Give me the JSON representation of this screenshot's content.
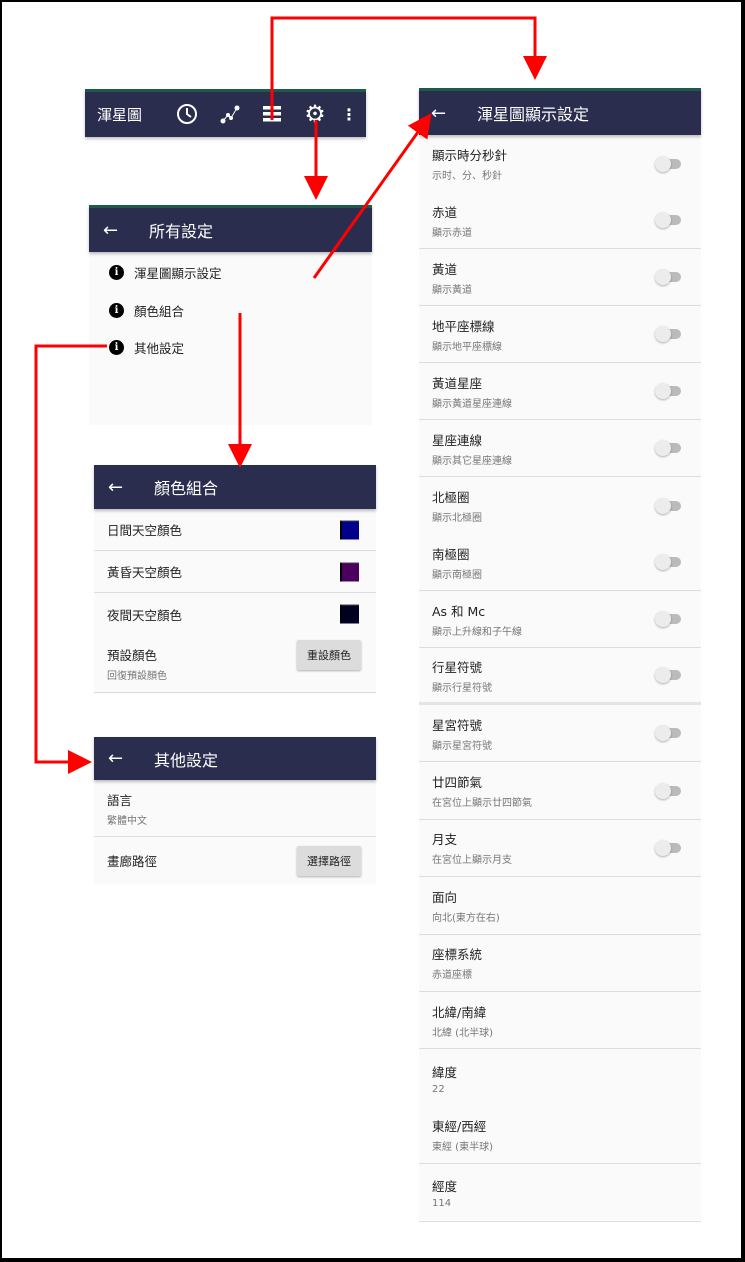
{
  "toolbar": {
    "title": "渾星圖",
    "icons": [
      "clock-icon",
      "constellation-icon",
      "list-icon",
      "gear-icon",
      "more-vert-icon"
    ]
  },
  "all_settings": {
    "title": "所有設定",
    "items": [
      {
        "label": "渾星圖顯示設定"
      },
      {
        "label": "顏色組合"
      },
      {
        "label": "其他設定"
      }
    ]
  },
  "color_scheme": {
    "title": "顏色組合",
    "rows": [
      {
        "label": "日間天空顏色",
        "color": "#00008b"
      },
      {
        "label": "黃昏天空顏色",
        "color": "#4b0060"
      },
      {
        "label": "夜間天空顏色",
        "color": "#000020"
      }
    ],
    "reset": {
      "label": "預設顏色",
      "sub": "回復預設顏色",
      "button": "重設顏色"
    }
  },
  "other_settings": {
    "title": "其他設定",
    "language": {
      "label": "語言",
      "value": "繁體中文"
    },
    "gallery": {
      "label": "畫廊路徑",
      "button": "選擇路徑"
    }
  },
  "display_settings": {
    "title": "渾星圖顯示設定",
    "rows": [
      {
        "label": "顯示時分秒針",
        "sub": "示时、分、秒針",
        "toggle": false
      },
      {
        "label": "赤道",
        "sub": "顯示赤道",
        "toggle": false
      },
      {
        "label": "黃道",
        "sub": "顯示黃道",
        "toggle": false
      },
      {
        "label": "地平座標線",
        "sub": "顯示地平座標線",
        "toggle": false
      },
      {
        "label": "黃道星座",
        "sub": "顯示黃道星座連線",
        "toggle": false
      },
      {
        "label": "星座連線",
        "sub": "顯示其它星座連線",
        "toggle": false
      },
      {
        "label": "北極圈",
        "sub": "顯示北極圈",
        "toggle": false
      },
      {
        "label": "南極圈",
        "sub": "顯示南極圈",
        "toggle": false
      },
      {
        "label": "As 和 Mc",
        "sub": "顯示上升線和子午線",
        "toggle": false
      },
      {
        "label": "行星符號",
        "sub": "顯示行星符號",
        "toggle": false
      },
      {
        "label": "星宮符號",
        "sub": "顯示星宮符號",
        "toggle": false
      },
      {
        "label": "廿四節氣",
        "sub": "在宮位上顯示廿四節氣",
        "toggle": false
      },
      {
        "label": "月支",
        "sub": "在宮位上顯示月支",
        "toggle": false
      },
      {
        "label": "面向",
        "sub": "向北(東方在右)"
      },
      {
        "label": "座標系統",
        "sub": "赤道座標"
      },
      {
        "label": "北緯/南緯",
        "sub": "北緯 (北半球)"
      },
      {
        "label": "緯度",
        "sub": "22"
      },
      {
        "label": "東經/西經",
        "sub": "東經 (東半球)"
      },
      {
        "label": "經度",
        "sub": "114"
      }
    ]
  },
  "colors": {
    "appbar": "#2b2d4f",
    "arrow": "#ff0000"
  }
}
